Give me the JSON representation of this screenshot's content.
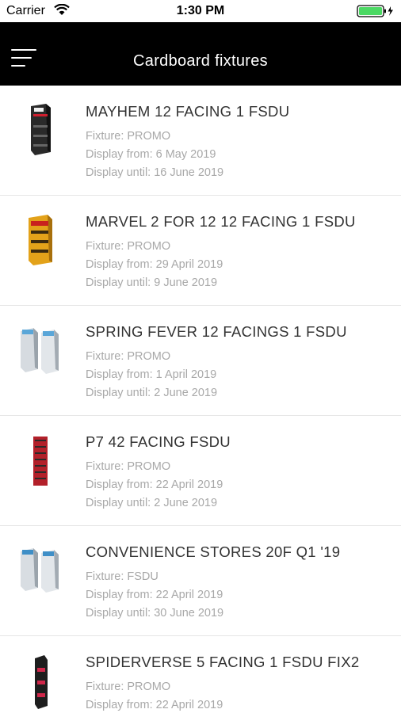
{
  "status_bar": {
    "carrier": "Carrier",
    "time": "1:30 PM"
  },
  "nav": {
    "title": "Cardboard fixtures",
    "menu_icon": "hamburger-menu-icon"
  },
  "colors": {
    "nav_background": "#000000",
    "title_text": "#333333",
    "detail_text": "#a8a8a8",
    "battery": "#4cd964"
  },
  "fixtures": [
    {
      "title": "MAYHEM 12 FACING 1 FSDU",
      "fixture": "Fixture: PROMO",
      "display_from": "Display from: 6 May 2019",
      "display_until": "Display until: 16 June 2019"
    },
    {
      "title": "MARVEL 2 FOR 12 12 FACING 1 FSDU",
      "fixture": "Fixture: PROMO",
      "display_from": "Display from: 29 April 2019",
      "display_until": "Display until: 9 June 2019"
    },
    {
      "title": "SPRING FEVER 12 FACINGS 1 FSDU",
      "fixture": "Fixture: PROMO",
      "display_from": "Display from: 1 April 2019",
      "display_until": "Display until: 2 June 2019"
    },
    {
      "title": "P7 42 FACING FSDU",
      "fixture": "Fixture: PROMO",
      "display_from": "Display from: 22 April 2019",
      "display_until": "Display until: 2 June 2019"
    },
    {
      "title": "CONVENIENCE STORES 20F Q1 '19",
      "fixture": "Fixture: FSDU",
      "display_from": "Display from: 22 April 2019",
      "display_until": "Display until: 30 June 2019"
    },
    {
      "title": "SPIDERVERSE 5 FACING 1 FSDU FIX2",
      "fixture": "Fixture: PROMO",
      "display_from": "Display from: 22 April 2019",
      "display_until": ""
    }
  ]
}
